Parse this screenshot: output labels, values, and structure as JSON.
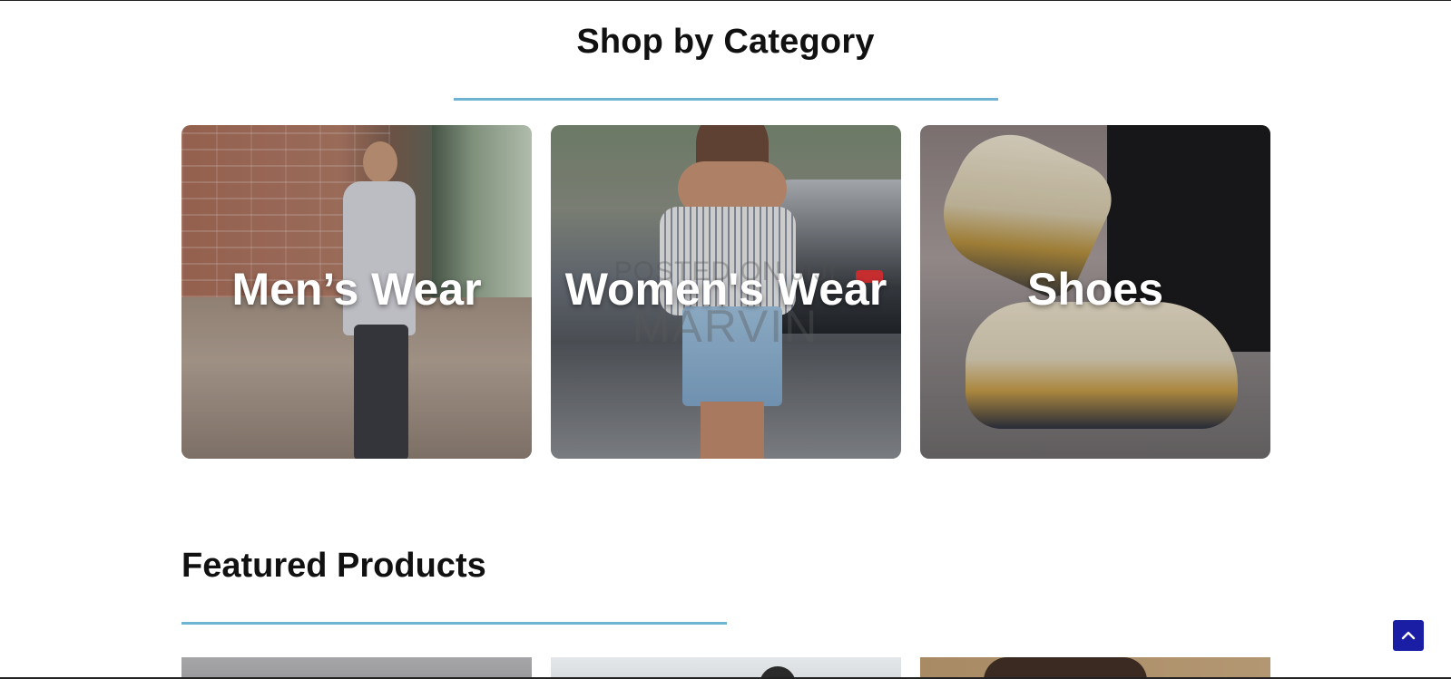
{
  "categories_section": {
    "title": "Shop by Category",
    "underline_color": "#6fb3d2",
    "cards": [
      {
        "label": "Men’s Wear"
      },
      {
        "label": "Women's Wear"
      },
      {
        "label": "Shoes"
      }
    ]
  },
  "watermark": {
    "line1": "POSTED ON JIJI",
    "line2": "MARVIN"
  },
  "featured_section": {
    "title": "Featured Products",
    "underline_color": "#6fb3d2"
  },
  "back_to_top": {
    "icon": "chevron-up-icon",
    "color": "#1a1ea5"
  }
}
